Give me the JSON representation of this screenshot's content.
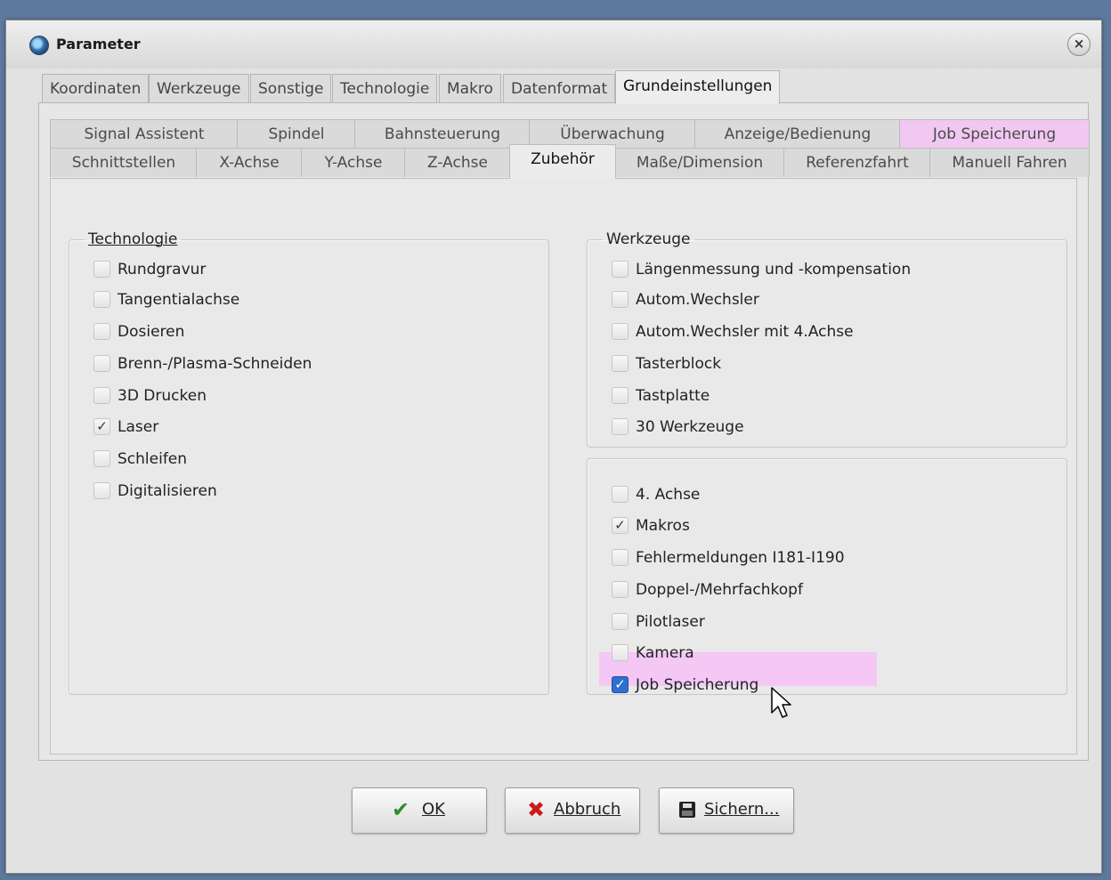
{
  "window": {
    "title": "Parameter",
    "close_glyph": "×"
  },
  "outer_tabs": [
    "Koordinaten",
    "Werkzeuge",
    "Sonstige",
    "Technologie",
    "Makro",
    "Datenformat",
    "Grundeinstellungen"
  ],
  "inner_tabs_row1": [
    "Signal Assistent",
    "Spindel",
    "Bahnsteuerung",
    "Überwachung",
    "Anzeige/Bedienung",
    "Job Speicherung"
  ],
  "inner_tabs_row2": [
    "Schnittstellen",
    "X-Achse",
    "Y-Achse",
    "Z-Achse",
    "Zubehör",
    "Maße/Dimension",
    "Referenzfahrt",
    "Manuell Fahren"
  ],
  "technologie": {
    "legend": "Technologie",
    "items": [
      {
        "label": "Rundgravur",
        "checked": false
      },
      {
        "label": "Tangentialachse",
        "checked": false
      },
      {
        "label": "Dosieren",
        "checked": false
      },
      {
        "label": "Brenn-/Plasma-Schneiden",
        "checked": false
      },
      {
        "label": "3D Drucken",
        "checked": false
      },
      {
        "label": "Laser",
        "checked": true
      },
      {
        "label": "Schleifen",
        "checked": false
      },
      {
        "label": "Digitalisieren",
        "checked": false
      }
    ]
  },
  "werkzeuge": {
    "legend": "Werkzeuge",
    "items": [
      {
        "label": "Längenmessung und -kompensation",
        "checked": false
      },
      {
        "label": "Autom.Wechsler",
        "checked": false
      },
      {
        "label": "Autom.Wechsler mit 4.Achse",
        "checked": false
      },
      {
        "label": "Tasterblock",
        "checked": false
      },
      {
        "label": "Tastplatte",
        "checked": false
      },
      {
        "label": "30 Werkzeuge",
        "checked": false
      }
    ]
  },
  "sonstiges": {
    "items": [
      {
        "label": "4. Achse",
        "checked": false
      },
      {
        "label": "Makros",
        "checked": true
      },
      {
        "label": "Fehlermeldungen I181-I190",
        "checked": false
      },
      {
        "label": "Doppel-/Mehrfachkopf",
        "checked": false
      },
      {
        "label": "Pilotlaser",
        "checked": false
      },
      {
        "label": "Kamera",
        "checked": false
      },
      {
        "label": "Job Speicherung",
        "checked": true
      }
    ]
  },
  "check_glyph": "✓",
  "buttons": {
    "ok": {
      "label": "OK",
      "icon": "✔"
    },
    "abbruch": {
      "label": "Abbruch",
      "icon": "✖"
    },
    "sichern": {
      "label": "Sichern...",
      "icon": "save-icon"
    }
  },
  "colors": {
    "highlight": "#f4c7f5",
    "ok_green": "#2e8b2e",
    "cancel_red": "#cc1a1a"
  }
}
